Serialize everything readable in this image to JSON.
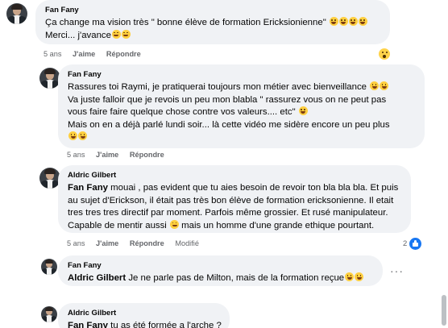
{
  "comments": [
    {
      "author": "Fan Fany",
      "lines": [
        "Ça change ma vision très \" bonne élève de formation Ericksionienne\"",
        "Merci... j'avance"
      ],
      "time": "5 ans",
      "like": "J'aime",
      "reply": "Répondre"
    },
    {
      "author": "Fan Fany",
      "lines": [
        "Rassures toi Raymi, je pratiquerai toujours mon métier avec bienveillance",
        "Va juste falloir que je revois un peu mon blabla \" rassurez vous on ne peut pas",
        "vous faire faire quelque chose contre vos valeurs.... etc\"",
        "Mais on en a déjà parlé lundi soir... là cette vidéo me sidère encore un peu plus"
      ],
      "time": "5 ans",
      "like": "J'aime",
      "reply": "Répondre"
    },
    {
      "author": "Aldric Gilbert",
      "mention": "Fan Fany",
      "lines": [
        " mouai , pas evident que tu aies besoin de revoir ton bla bla bla. Et puis",
        "au sujet d'Erickson, il était pas très bon élève de formation ericksonienne. Il etait",
        "tres tres tres directif par moment. Parfois même grossier. Et rusé manipulateur.",
        "Capable de mentir aussi",
        " mais un homme d'une grande ethique pourtant."
      ],
      "time": "5 ans",
      "like": "J'aime",
      "reply": "Répondre",
      "edited": "Modifié",
      "like_count": "2"
    },
    {
      "author": "Fan Fany",
      "mention": "Aldric Gilbert",
      "lines": [
        " Je ne parle pas de Milton, mais de la formation reçue"
      ],
      "time": "5 ans",
      "like": "J'aime",
      "reply": "Répondre"
    },
    {
      "author": "Aldric Gilbert",
      "mention": "Fan Fany",
      "lines": [
        " tu as été formée a l'arche ?"
      ]
    }
  ],
  "icons": {
    "reaction": "wow-reaction-icon",
    "like": "like-icon",
    "more": "more-options-icon",
    "emoji": "emoji-icon"
  },
  "colors": {
    "bubble": "#f0f2f5",
    "meta": "#65676b",
    "like_blue": "#1877f2"
  }
}
